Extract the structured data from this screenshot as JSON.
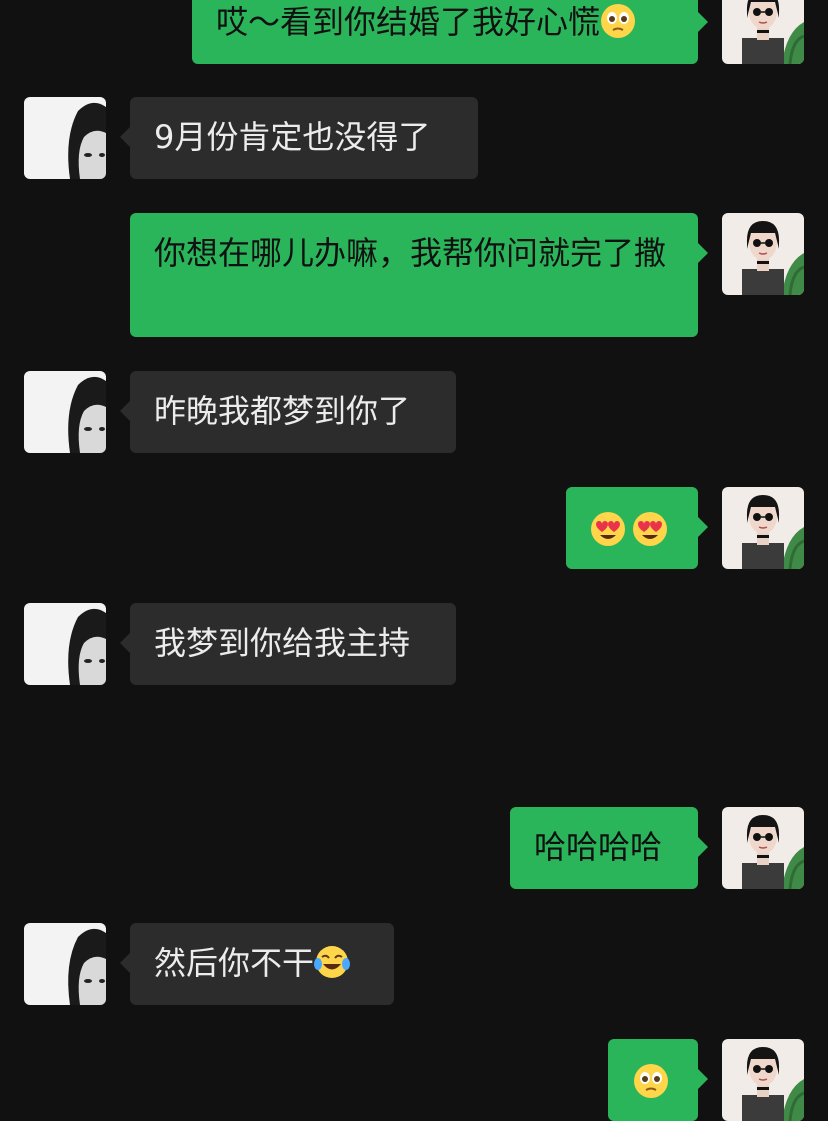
{
  "messages": [
    {
      "side": "me",
      "text": "哎～看到你结婚了我好心慌",
      "emoji": "pleading-face"
    },
    {
      "side": "other",
      "text": "9月份肯定也没得了"
    },
    {
      "side": "me",
      "text": "你想在哪儿办嘛，我帮你问就完了撒"
    },
    {
      "side": "other",
      "text": "昨晚我都梦到你了"
    },
    {
      "side": "me",
      "text": "",
      "emoji": "heart-eyes-face heart-eyes-face"
    },
    {
      "side": "other",
      "text": "我梦到你给我主持"
    },
    {
      "side": "me",
      "text": "哈哈哈哈"
    },
    {
      "side": "other",
      "text": "然后你不干",
      "emoji": "tears-of-joy-face"
    },
    {
      "side": "me",
      "text": "",
      "emoji": "pleading-face"
    }
  ],
  "colors": {
    "background": "#111111",
    "bubble_me": "#2ab55b",
    "bubble_other": "#2c2c2c",
    "text_me": "#111111",
    "text_other": "#ececec"
  }
}
